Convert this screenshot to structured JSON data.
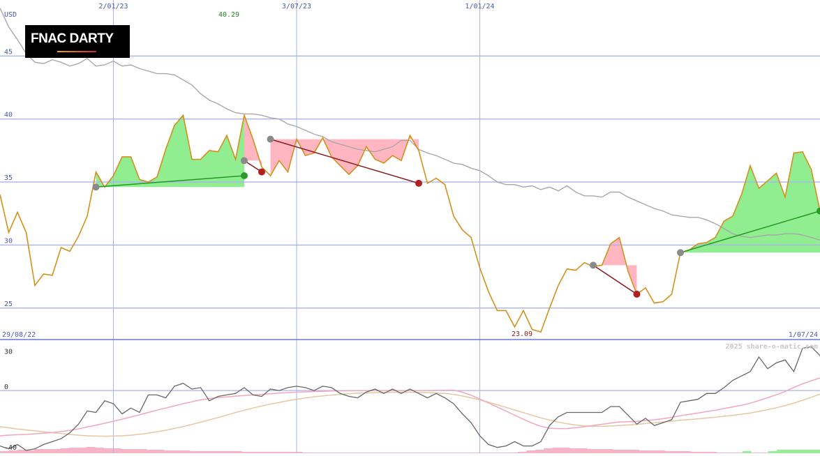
{
  "chart_data": [
    {
      "type": "line",
      "subtype": "price-chart",
      "currency": "USD",
      "start_date": "29/08/22",
      "end_date": "1/07/24",
      "x_tick_labels": [
        "2/01/23",
        "3/07/23",
        "1/01/24"
      ],
      "y_ticks": [
        25,
        30,
        35,
        40,
        45
      ],
      "ylim": [
        22.5,
        49
      ],
      "high_label": "40.29",
      "low_label": "23.09",
      "grid": true,
      "series": [
        {
          "key": "price",
          "color": "#d4901a",
          "values": [
            34,
            31,
            32.6,
            31,
            26.8,
            27.7,
            27.6,
            29.8,
            29.5,
            30.7,
            32.3,
            35.8,
            34.6,
            35.5,
            37,
            37,
            35.2,
            35,
            35.4,
            37.6,
            39.5,
            40.3,
            36.8,
            36.8,
            37.5,
            37.4,
            38.7,
            36.8,
            40.3,
            38.4,
            36.2,
            35.5,
            36.7,
            35.8,
            38.4,
            37.1,
            37.3,
            38.5,
            37,
            36.3,
            35.6,
            36.3,
            37.8,
            36.8,
            36.5,
            37.1,
            36.7,
            38.7,
            37.5,
            34.9,
            35.3,
            34.8,
            32.3,
            31.2,
            30.6,
            28.2,
            26.3,
            24.8,
            24.8,
            23.5,
            24.8,
            23.3,
            23.1,
            25,
            26.8,
            28.1,
            28,
            28.6,
            28.3,
            28.4,
            30.1,
            30.6,
            27.9,
            26.1,
            26.6,
            25.4,
            25.5,
            26.1,
            29.4,
            29.6,
            30.1,
            30.2,
            30.6,
            31.9,
            32.3,
            34,
            36.3,
            34.5,
            35.1,
            35.7,
            33.8,
            37.3,
            37.4,
            36,
            32.7
          ]
        },
        {
          "key": "moving-average",
          "color": "#a8a8a8",
          "values": [
            48.8,
            47.3,
            46.3,
            45.2,
            44.5,
            44.4,
            44.7,
            44.5,
            44.2,
            44.4,
            44.8,
            44.2,
            44.3,
            44.6,
            44.2,
            44.3,
            44,
            43.8,
            43.6,
            43.6,
            43.5,
            43.1,
            42.7,
            42,
            41.5,
            41.2,
            40.8,
            40.5,
            40.4,
            40.4,
            40.3,
            40.1,
            40,
            39.6,
            39.4,
            39.1,
            38.8,
            38.6,
            38.2,
            38,
            37.8,
            37.6,
            37.5,
            37.4,
            37.6,
            37.8,
            38.3,
            38.3,
            37.6,
            37.3,
            37.1,
            36.8,
            36.5,
            36.4,
            36.1,
            35.9,
            35.5,
            35,
            34.8,
            34.8,
            34.6,
            34.7,
            34.4,
            34.6,
            34.3,
            34.7,
            34.2,
            33.9,
            33.9,
            33.8,
            34.2,
            34.2,
            33.8,
            33.5,
            33.2,
            32.9,
            32.7,
            32.4,
            32.3,
            32.2,
            32.2,
            32,
            31.7,
            31.3,
            30.9,
            30.7,
            30.6,
            30.7,
            30.8,
            30.8,
            30.9,
            30.9,
            30.8,
            30.6,
            30.4
          ]
        }
      ],
      "trend_segments": [
        {
          "from": 11,
          "to": 28,
          "start_value": 34.6,
          "end_value": 35.5,
          "direction": "up"
        },
        {
          "from": 28,
          "to": 30,
          "start_value": 36.7,
          "end_value": 35.8,
          "direction": "down"
        },
        {
          "from": 31,
          "to": 48,
          "start_value": 38.4,
          "end_value": 34.9,
          "direction": "down"
        },
        {
          "from": 68,
          "to": 73,
          "start_value": 28.4,
          "end_value": 26.1,
          "direction": "down"
        },
        {
          "from": 78,
          "to": 94,
          "start_value": 29.4,
          "end_value": 32.7,
          "direction": "up"
        }
      ],
      "colors": {
        "up": "#90ee90",
        "down": "#ffb6c1",
        "up_line": "#229922",
        "down_line": "#8b1a1a",
        "grid": "#a8b2f0",
        "axis_text": "#4a5ab0"
      }
    },
    {
      "type": "line",
      "subtype": "momentum-oscillator",
      "y_ticks": [
        30,
        0,
        -40
      ],
      "ylim": [
        -42,
        34
      ],
      "series": [
        {
          "key": "momentum",
          "color": "#666666",
          "values": [
            -38,
            -40,
            -37,
            -41,
            -40,
            -37,
            -35,
            -33,
            -29,
            -23,
            -14,
            -15,
            -7,
            -9,
            -16,
            -12,
            -15,
            -3,
            -3,
            -5,
            3,
            5,
            1,
            2,
            -7,
            -4,
            -3,
            -2,
            2,
            -3,
            -4,
            1,
            0,
            2,
            3,
            2,
            0,
            3,
            2,
            -2,
            -4,
            -5,
            -1,
            1,
            -2,
            1,
            -2,
            1,
            -2,
            -5,
            -2,
            -5,
            -9,
            -16,
            -22,
            -31,
            -37,
            -39,
            -38,
            -35,
            -38,
            -38,
            -35,
            -24,
            -18,
            -15,
            -15,
            -15,
            -15,
            -15,
            -11,
            -11,
            -17,
            -23,
            -19,
            -24,
            -22,
            -20,
            -8,
            -7,
            -6,
            -2,
            -2,
            2,
            7,
            10,
            13,
            23,
            15,
            19,
            21,
            13,
            29,
            30,
            24,
            7
          ]
        },
        {
          "key": "ma-fast",
          "color": "#f4a6bd",
          "values": [
            -31,
            -30.6,
            -30.3,
            -30.1,
            -29.6,
            -29.2,
            -28.8,
            -28.1,
            -27.3,
            -26.3,
            -25,
            -23.8,
            -22.4,
            -21,
            -19.6,
            -18.1,
            -16.6,
            -15,
            -13.4,
            -12,
            -10.5,
            -9,
            -7.7,
            -6.4,
            -5.5,
            -4.8,
            -4.4,
            -3.8,
            -3.4,
            -3,
            -2.6,
            -2.2,
            -1.7,
            -1.4,
            -1.1,
            -0.9,
            -0.7,
            -0.5,
            -0.3,
            -0.2,
            -0.2,
            -0.1,
            0,
            0,
            0,
            0,
            0,
            0,
            0,
            0,
            0.1,
            0.2,
            0.3,
            -1.1,
            -3.2,
            -5.8,
            -8.5,
            -11.3,
            -14.1,
            -16.9,
            -19.7,
            -22.3,
            -24.5,
            -25.8,
            -26.1,
            -26,
            -25.5,
            -24.8,
            -24,
            -23.1,
            -22.3,
            -21.5,
            -21.4,
            -21.1,
            -20.6,
            -20,
            -19.3,
            -18.4,
            -17.3,
            -16.3,
            -15.4,
            -14.4,
            -13.5,
            -12.3,
            -11.2,
            -10.1,
            -8.7,
            -6.8,
            -4.9,
            -2.9,
            -0.6,
            2.1,
            4.6,
            6.7,
            8.6,
            8.6
          ]
        },
        {
          "key": "ma-slow",
          "color": "#e4c8a0",
          "values": [
            -24.8,
            -25.5,
            -26.3,
            -27,
            -27.6,
            -28.3,
            -28.9,
            -29.5,
            -30.1,
            -30.6,
            -31,
            -31.2,
            -31.3,
            -31.2,
            -31,
            -30.6,
            -30,
            -29.2,
            -28.3,
            -27.2,
            -26,
            -24.7,
            -23.2,
            -21.7,
            -20.1,
            -18.5,
            -16.8,
            -15.1,
            -13.5,
            -12,
            -10.6,
            -9.3,
            -8.1,
            -7,
            -6,
            -5.1,
            -4.3,
            -3.6,
            -3.1,
            -2.6,
            -2.2,
            -1.8,
            -1.6,
            -1.4,
            -1.3,
            -1.2,
            -1.2,
            -1.2,
            -1.3,
            -1.4,
            -1.6,
            -2,
            -2.7,
            -3.7,
            -5,
            -6.4,
            -8,
            -9.7,
            -11.5,
            -13.3,
            -15.1,
            -17,
            -18.7,
            -20.2,
            -21.6,
            -22.8,
            -23.6,
            -24.2,
            -24.5,
            -24.5,
            -24.3,
            -24,
            -23.6,
            -23.2,
            -22.6,
            -22.1,
            -21.5,
            -21,
            -20.4,
            -19.9,
            -19.4,
            -18.8,
            -18.3,
            -17.6,
            -17,
            -16.2,
            -15.4,
            -14.3,
            -13.1,
            -11.8,
            -10.3,
            -8.6,
            -6.7,
            -4.6,
            -2.4,
            -1
          ]
        }
      ],
      "volume_bars": {
        "pink_heights": [
          3,
          4,
          5,
          4,
          6,
          6,
          6,
          7,
          8,
          8,
          9,
          8,
          7,
          7,
          6,
          6,
          6,
          5,
          5,
          4,
          4,
          4,
          3,
          3,
          3,
          3,
          3,
          3,
          2,
          2,
          2,
          2,
          2,
          2,
          2,
          1,
          1,
          1,
          1,
          1,
          1,
          1,
          1,
          1,
          1,
          1,
          1,
          1,
          1,
          1,
          1,
          1,
          1,
          1,
          1,
          1,
          1,
          1,
          1,
          1,
          2,
          4,
          5,
          7,
          8,
          8,
          7,
          7,
          6,
          6,
          6,
          5,
          5,
          5,
          4,
          4,
          4,
          3,
          3,
          3,
          2,
          2,
          2,
          1,
          1,
          1,
          1,
          1,
          1,
          1,
          1,
          1,
          1,
          1,
          1,
          1
        ],
        "green_heights": [
          0,
          0,
          0,
          0,
          0,
          0,
          0,
          0,
          0,
          0,
          0,
          0,
          0,
          0,
          0,
          0,
          0,
          0,
          0,
          0,
          0,
          0,
          0,
          0,
          0,
          0,
          0,
          0,
          0,
          0,
          0,
          0,
          0,
          0,
          0,
          0,
          0,
          0,
          0,
          0,
          0,
          0,
          0,
          0,
          0,
          0,
          0,
          0,
          0,
          0,
          0,
          0,
          0,
          0,
          0,
          0,
          0,
          0,
          0,
          0,
          0,
          0,
          0,
          0,
          0,
          0,
          0,
          0,
          0,
          0,
          0,
          0,
          0,
          0,
          0,
          0,
          0,
          0,
          0,
          0,
          0,
          0,
          0,
          0,
          0,
          0,
          3,
          0,
          0,
          3,
          5,
          5,
          5,
          5,
          5,
          5
        ]
      }
    }
  ],
  "logo": {
    "text": "FNAC DARTY"
  },
  "watermark": "2025 share-o-matic.com"
}
